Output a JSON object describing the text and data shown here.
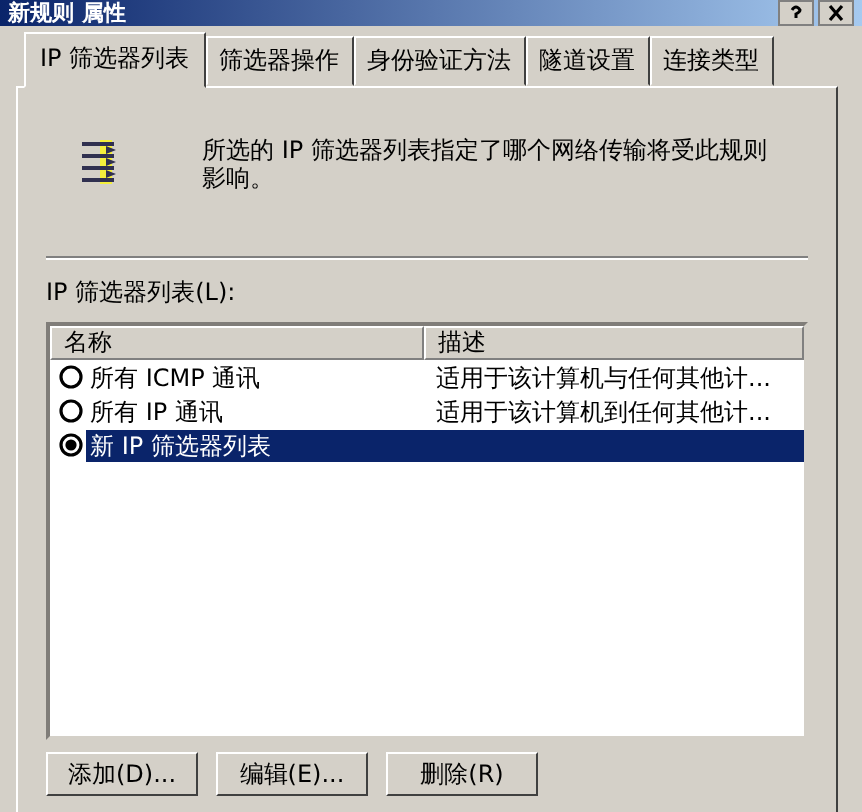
{
  "window": {
    "title": "新规则 属性"
  },
  "tabs": [
    {
      "label": "IP 筛选器列表",
      "selected": true
    },
    {
      "label": "筛选器操作",
      "selected": false
    },
    {
      "label": "身份验证方法",
      "selected": false
    },
    {
      "label": "隧道设置",
      "selected": false
    },
    {
      "label": "连接类型",
      "selected": false
    }
  ],
  "description": "所选的 IP 筛选器列表指定了哪个网络传输将受此规则影响。",
  "list": {
    "label": "IP 筛选器列表(L):",
    "columns": [
      "名称",
      "描述"
    ],
    "rows": [
      {
        "name": "所有 ICMP 通讯",
        "description": "适用于该计算机与任何其他计...",
        "selected": false
      },
      {
        "name": "所有 IP 通讯",
        "description": "适用于该计算机到任何其他计...",
        "selected": false
      },
      {
        "name": "新 IP 筛选器列表",
        "description": "",
        "selected": true
      }
    ]
  },
  "buttons": [
    "添加(D)...",
    "编辑(E)...",
    "删除(R)"
  ]
}
